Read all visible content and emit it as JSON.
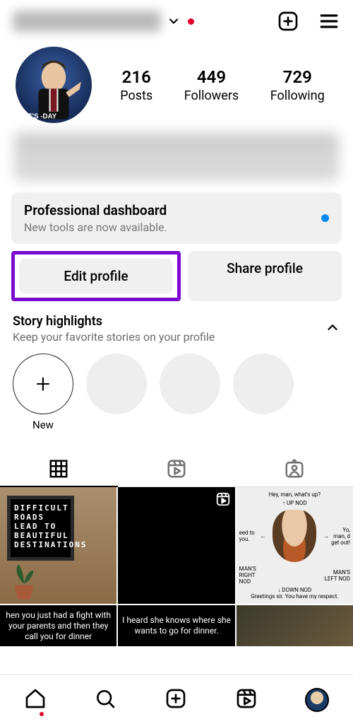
{
  "header": {
    "username_obscured": true,
    "has_notification_dot": true
  },
  "profile": {
    "stats": {
      "posts": {
        "count": "216",
        "label": "Posts"
      },
      "followers": {
        "count": "449",
        "label": "Followers"
      },
      "following": {
        "count": "729",
        "label": "Following"
      }
    }
  },
  "pro_dashboard": {
    "title": "Professional dashboard",
    "subtitle": "New tools are now available.",
    "has_dot": true
  },
  "buttons": {
    "edit": "Edit profile",
    "share": "Share profile"
  },
  "highlights": {
    "title": "Story highlights",
    "subtitle": "Keep your favorite stories on your profile",
    "new_label": "New",
    "plus": "+"
  },
  "tabs": {
    "grid": "grid",
    "reels": "reels",
    "tagged": "tagged",
    "active": "grid"
  },
  "grid": {
    "cell1_text": "DIFFICULT\nROADS\nLEAD TO\nBEAUTIFUL\nDESTINATIONS",
    "cell3": {
      "top": "Hey, man, what's up?",
      "up": "UP NOD",
      "left_a": "eed to you.",
      "left_b": "MAN'S RIGHT NOD",
      "right_a": "Yo, man, d get out!",
      "right_b": "MAN'S LEFT NOD",
      "down": "DOWN NOD",
      "bottom": "Greetings sir. You have my respect."
    },
    "cell4_text": "hen you just had a fight with your parents and then they call you for dinner",
    "cell5_text": "I heard she knows where she wants to go for dinner."
  },
  "annotation": {
    "highlighted_button": "edit"
  }
}
